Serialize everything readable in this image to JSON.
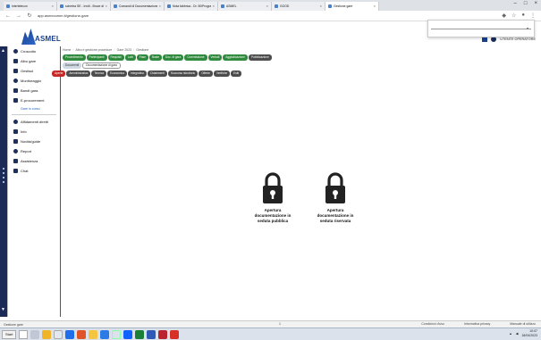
{
  "browser": {
    "tabs": [
      {
        "label": "Intertelecon"
      },
      {
        "label": "scherba SE - Inviti - Bruce dir..."
      },
      {
        "label": "Comandi di Documentazione prove - Go..."
      },
      {
        "label": "Nota fabbrica - Dr. 50/ProgramC"
      },
      {
        "label": "ASMEL"
      },
      {
        "label": "GOOD"
      },
      {
        "label": "Gestione gare"
      }
    ],
    "url": "app.asmecomm.it/gestione-gare"
  },
  "dropdown": {
    "value": "",
    "placeholder": ""
  },
  "header": {
    "logo_text": "ASMEL",
    "user_label": "UTENTE OPERATORE"
  },
  "sidebar": {
    "items": [
      {
        "label": "Cruscotto",
        "icon": "dashboard-icon"
      },
      {
        "label": "Albo gare",
        "icon": "list-icon"
      },
      {
        "label": "Gestisci",
        "icon": "gear-icon"
      },
      {
        "label": "Monitoraggio",
        "icon": "chart-icon"
      },
      {
        "label": "Bandi gara",
        "icon": "document-icon"
      },
      {
        "label": "E-procurement",
        "icon": "cart-icon"
      }
    ],
    "subitem": "Gare in corso",
    "items2": [
      {
        "label": "Affidamenti diretti",
        "icon": "handshake-icon"
      },
      {
        "label": "Info",
        "icon": "info-icon"
      },
      {
        "label": "Novità/guide",
        "icon": "book-icon"
      },
      {
        "label": "Report",
        "icon": "report-icon"
      },
      {
        "label": "Assistenza",
        "icon": "support-icon"
      },
      {
        "label": "Chat",
        "icon": "chat-icon"
      }
    ]
  },
  "breadcrumb": [
    "Home",
    "Albo e gestione procedure",
    "Gare 2023",
    "Gestione"
  ],
  "pills_row1": [
    {
      "label": "Procedimento",
      "style": "green"
    },
    {
      "label": "Partecipanti",
      "style": "green"
    },
    {
      "label": "Requisiti",
      "style": "green"
    },
    {
      "label": "Lotti",
      "style": "green"
    },
    {
      "label": "Fase",
      "style": "green"
    },
    {
      "label": "Buste",
      "style": "green"
    },
    {
      "label": "Doc. di gara",
      "style": "green"
    },
    {
      "label": "Commissione",
      "style": "green"
    },
    {
      "label": "Verbali",
      "style": "green"
    },
    {
      "label": "Aggiudicazione",
      "style": "green"
    },
    {
      "label": "Pubblicazione",
      "style": "dark"
    }
  ],
  "pills_row2": [
    {
      "label": "Documenti",
      "style": "light"
    },
    {
      "label": "Documentazione di gara",
      "style": "white"
    }
  ],
  "pills_row3": [
    {
      "label": "Aperte",
      "style": "red"
    },
    {
      "label": "Amministrativa",
      "style": "dark"
    },
    {
      "label": "Tecnica",
      "style": "dark"
    },
    {
      "label": "Economica",
      "style": "dark"
    },
    {
      "label": "Integrativa",
      "style": "dark"
    },
    {
      "label": "Chiarimenti",
      "style": "dark"
    },
    {
      "label": "Soccorso istruttorio",
      "style": "dark"
    },
    {
      "label": "Offerte",
      "style": "dark"
    },
    {
      "label": "Verifiche",
      "style": "dark"
    },
    {
      "label": "Esiti",
      "style": "dark"
    }
  ],
  "locks": [
    {
      "label_line1": "Apertura",
      "label_line2": "documentazione in",
      "label_line3": "seduta pubblica"
    },
    {
      "label_line1": "Apertura",
      "label_line2": "documentazione in",
      "label_line3": "seduta riservata"
    }
  ],
  "status": {
    "left": "Gestione gare",
    "page": "1",
    "links": [
      "Condizioni d'uso",
      "Informativa privacy",
      "Manuale di utilizzo"
    ]
  },
  "taskbar": {
    "start_label": "Start",
    "clock_time": "10:07",
    "clock_date": "18/04/2023"
  },
  "colors": {
    "green_pill": "#2f8a3d",
    "dark_pill": "#4d4d4d",
    "red_pill": "#c62828",
    "sidebar_strip": "#1c2a58",
    "brand": "#1a3f8f"
  }
}
